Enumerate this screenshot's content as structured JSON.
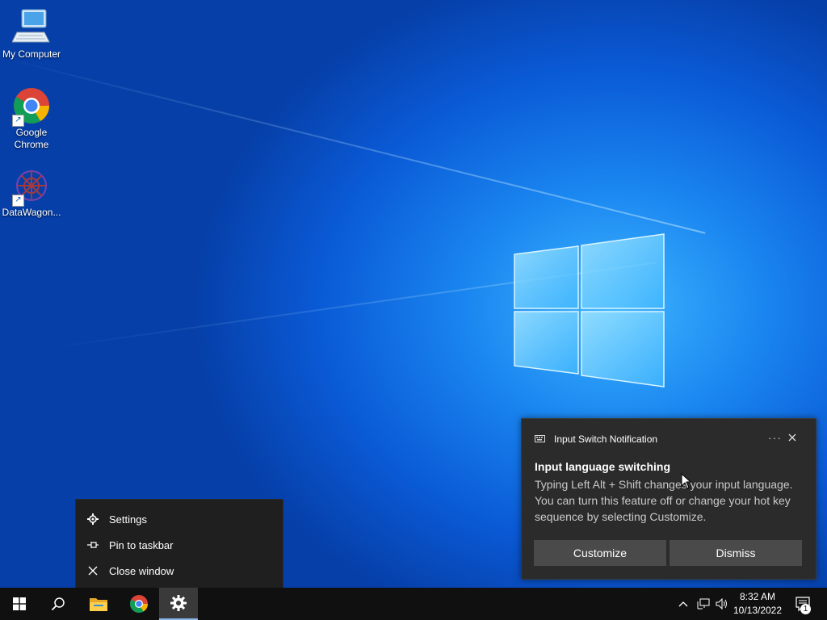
{
  "desktop": {
    "icons": [
      {
        "label": "My Computer",
        "icon": "computer-icon"
      },
      {
        "label": "Google\nChrome",
        "icon": "chrome-icon"
      },
      {
        "label": "DataWagon...",
        "icon": "datawagon-icon"
      }
    ]
  },
  "context_menu": {
    "items": [
      {
        "label": "Settings",
        "icon": "gear-icon"
      },
      {
        "label": "Pin to taskbar",
        "icon": "pin-icon"
      },
      {
        "label": "Close window",
        "icon": "close-icon"
      }
    ]
  },
  "notification": {
    "app_name": "Input Switch Notification",
    "more": "···",
    "title": "Input language switching",
    "body": "Typing Left Alt + Shift changes your input language. You can turn this feature off or change your hot key sequence by selecting Customize.",
    "buttons": {
      "customize": "Customize",
      "dismiss": "Dismiss"
    }
  },
  "taskbar": {
    "pinned": [
      "start-icon",
      "search-icon",
      "file-explorer-icon",
      "chrome-icon",
      "settings-icon"
    ],
    "active": "settings-icon",
    "clock": {
      "time": "8:32 AM",
      "date": "10/13/2022"
    },
    "notification_count": "1"
  },
  "colors": {
    "accent": "#0a66e0",
    "taskbar": "#101010",
    "toast": "#2b2b2b",
    "menu": "#1f1f1f"
  }
}
